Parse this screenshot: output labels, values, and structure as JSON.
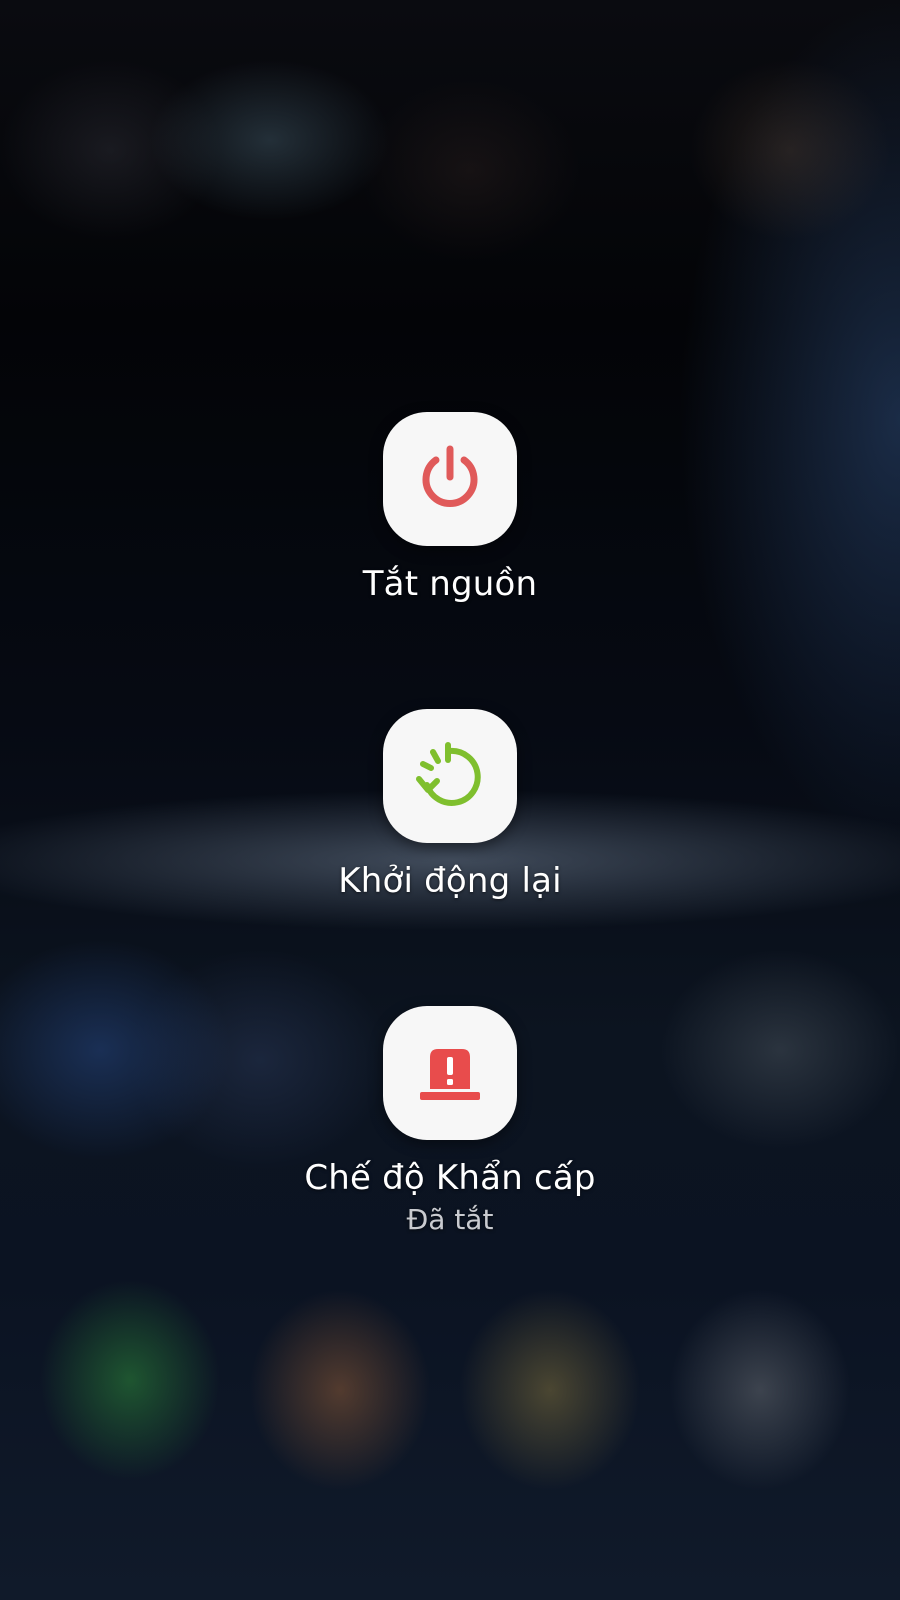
{
  "power_menu": {
    "items": [
      {
        "label": "Tắt nguồn",
        "icon": "power-icon"
      },
      {
        "label": "Khởi động lại",
        "icon": "restart-icon"
      },
      {
        "label": "Chế độ Khẩn cấp",
        "sublabel": "Đã tắt",
        "icon": "emergency-siren-icon"
      }
    ]
  },
  "colors": {
    "power": "#e05a5a",
    "restart": "#7fbf2e",
    "emergency": "#e84c4c",
    "tile_background": "#f7f7f7"
  }
}
